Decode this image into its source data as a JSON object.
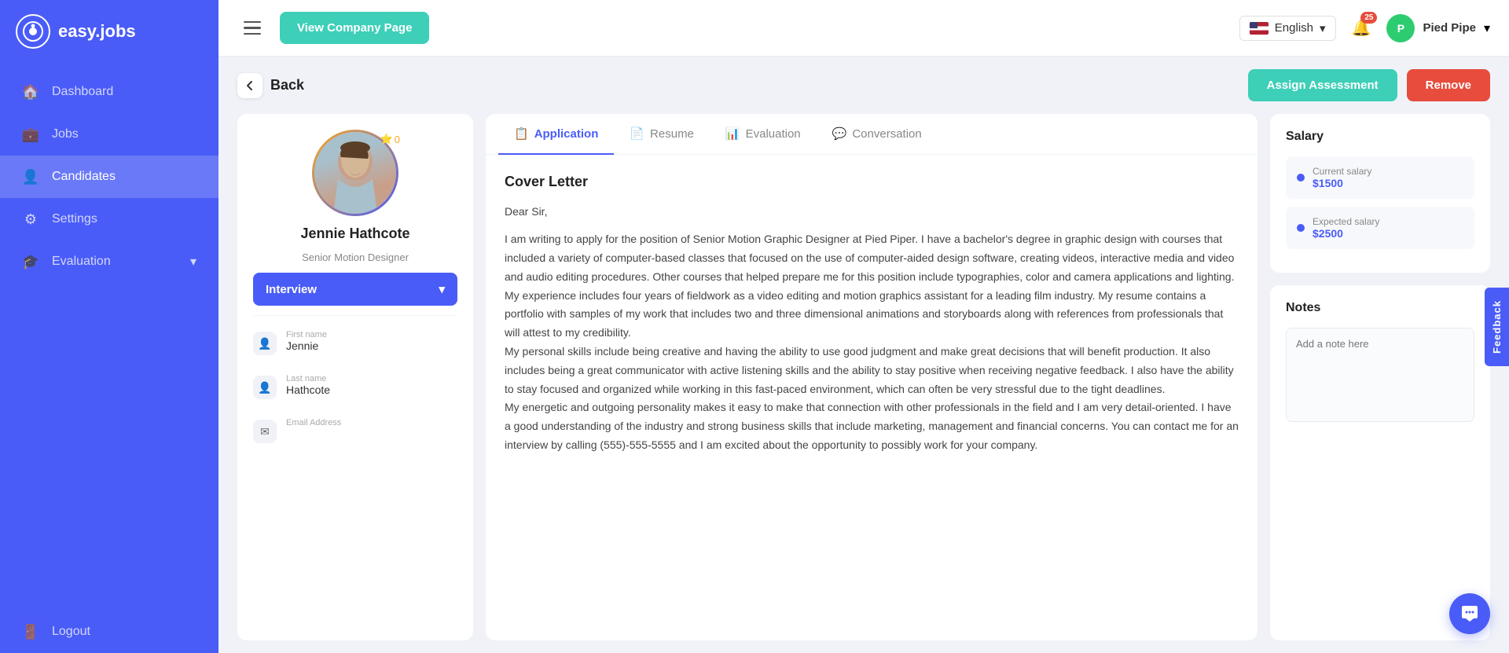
{
  "app": {
    "name": "easy.jobs",
    "logo_char": "@"
  },
  "sidebar": {
    "items": [
      {
        "id": "dashboard",
        "label": "Dashboard",
        "icon": "🏠"
      },
      {
        "id": "jobs",
        "label": "Jobs",
        "icon": "💼"
      },
      {
        "id": "candidates",
        "label": "Candidates",
        "icon": "👤",
        "active": true
      },
      {
        "id": "settings",
        "label": "Settings",
        "icon": "⚙"
      },
      {
        "id": "evaluation",
        "label": "Evaluation",
        "icon": "🎓",
        "has_arrow": true
      }
    ],
    "logout_label": "Logout"
  },
  "topbar": {
    "view_company_label": "View Company Page",
    "language": "English",
    "notification_count": "25",
    "user_name": "Pied Pipe"
  },
  "page": {
    "back_label": "Back",
    "assign_assessment_label": "Assign Assessment",
    "remove_label": "Remove"
  },
  "candidate": {
    "name": "Jennie Hathcote",
    "title": "Senior Motion Designer",
    "star_count": "0",
    "status": "Interview",
    "first_name_label": "First name",
    "first_name": "Jennie",
    "last_name_label": "Last name",
    "last_name": "Hathcote",
    "email_label": "Email Address"
  },
  "tabs": [
    {
      "id": "application",
      "label": "Application",
      "icon": "📋",
      "active": true
    },
    {
      "id": "resume",
      "label": "Resume",
      "icon": "📄"
    },
    {
      "id": "evaluation",
      "label": "Evaluation",
      "icon": "📊"
    },
    {
      "id": "conversation",
      "label": "Conversation",
      "icon": "💬"
    }
  ],
  "cover_letter": {
    "title": "Cover Letter",
    "greeting": "Dear Sir,",
    "body": "I am writing to apply for the position of Senior Motion Graphic Designer at Pied Piper. I have a bachelor's degree in graphic design with courses that included a variety of computer-based classes that focused on the use of computer-aided design software, creating videos, interactive media and video and audio editing procedures. Other courses that helped prepare me for this position include typographies, color and camera applications and lighting.\nMy experience includes four years of fieldwork as a video editing and motion graphics assistant for a leading film industry. My resume contains a portfolio with samples of my work that includes two and three dimensional animations and storyboards along with references from professionals that will attest to my credibility.\nMy personal skills include being creative and having the ability to use good judgment and make great decisions that will benefit production. It also includes being a great communicator with active listening skills and the ability to stay positive when receiving negative feedback. I also have the ability to stay focused and organized while working in this fast-paced environment, which can often be very stressful due to the tight deadlines.\nMy energetic and outgoing personality makes it easy to make that connection with other professionals in the field and I am very detail-oriented. I have a good understanding of the industry and strong business skills that include marketing, management and financial concerns. You can contact me for an interview by calling (555)-555-5555 and I am excited about the opportunity to possibly work for your company."
  },
  "salary": {
    "title": "Salary",
    "current_label": "Current salary",
    "current_value": "$1500",
    "expected_label": "Expected salary",
    "expected_value": "$2500"
  },
  "notes": {
    "title": "Notes",
    "placeholder": "Add a note here"
  },
  "feedback": {
    "label": "Feedback"
  }
}
